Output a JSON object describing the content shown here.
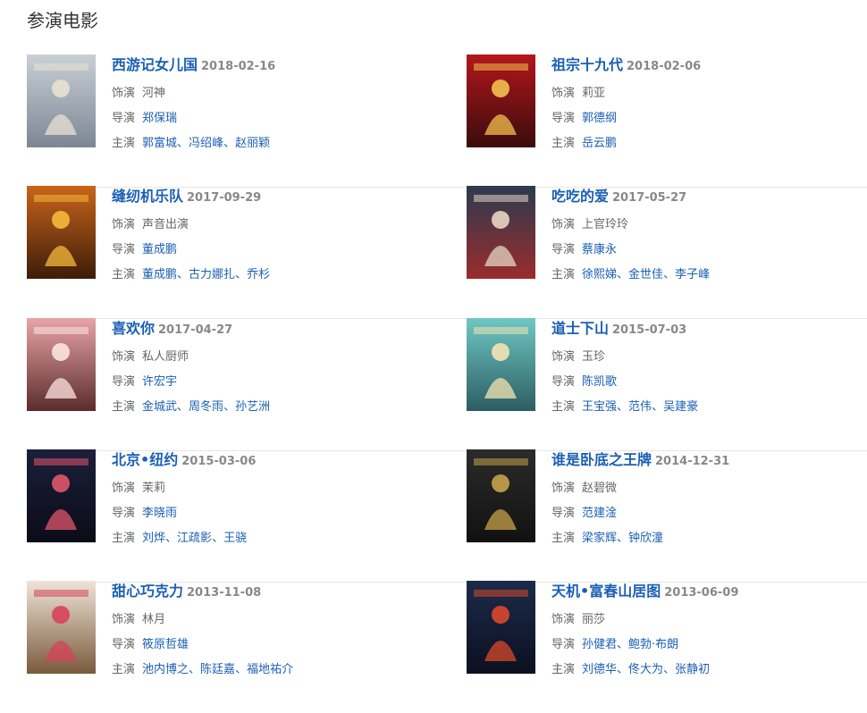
{
  "section_title": "参演电影",
  "labels": {
    "role": "饰演",
    "director": "导演",
    "starring": "主演"
  },
  "separator": "、",
  "films": [
    {
      "title": "西游记女儿国",
      "date": "2018-02-16",
      "role": "河神",
      "director": [
        "郑保瑞"
      ],
      "starring": [
        "郭富城",
        "冯绍峰",
        "赵丽颖"
      ]
    },
    {
      "title": "祖宗十九代",
      "date": "2018-02-06",
      "role": "莉亚",
      "director": [
        "郭德纲"
      ],
      "starring": [
        "岳云鹏"
      ]
    },
    {
      "title": "缝纫机乐队",
      "date": "2017-09-29",
      "role": "声音出演",
      "director": [
        "董成鹏"
      ],
      "starring": [
        "董成鹏",
        "古力娜扎",
        "乔杉"
      ]
    },
    {
      "title": "吃吃的爱",
      "date": "2017-05-27",
      "role": "上官玲玲",
      "director": [
        "蔡康永"
      ],
      "starring": [
        "徐熙娣",
        "金世佳",
        "李子峰"
      ]
    },
    {
      "title": "喜欢你",
      "date": "2017-04-27",
      "role": "私人厨师",
      "director": [
        "许宏宇"
      ],
      "starring": [
        "金城武",
        "周冬雨",
        "孙艺洲"
      ]
    },
    {
      "title": "道士下山",
      "date": "2015-07-03",
      "role": "玉珍",
      "director": [
        "陈凯歌"
      ],
      "starring": [
        "王宝强",
        "范伟",
        "吴建豪"
      ]
    },
    {
      "title": "北京•纽约",
      "date": "2015-03-06",
      "role": "茉莉",
      "director": [
        "李晓雨"
      ],
      "starring": [
        "刘烨",
        "江疏影",
        "王骁"
      ]
    },
    {
      "title": "谁是卧底之王牌",
      "date": "2014-12-31",
      "role": "赵碧微",
      "director": [
        "范建淦"
      ],
      "starring": [
        "梁家辉",
        "钟欣潼"
      ]
    },
    {
      "title": "甜心巧克力",
      "date": "2013-11-08",
      "role": "林月",
      "director": [
        "筱原哲雄"
      ],
      "starring": [
        "池内博之",
        "陈廷嘉",
        "福地祐介"
      ]
    },
    {
      "title": "天机•富春山居图",
      "date": "2013-06-09",
      "role": "丽莎",
      "director": [
        "孙健君",
        "鲍勃·布朗"
      ],
      "starring": [
        "刘德华",
        "佟大为",
        "张静初"
      ]
    }
  ],
  "posters": [
    {
      "icon": "poster-image",
      "bg": "#c9cfd6",
      "accent": "#e8e2d2",
      "dark": "#7d8794"
    },
    {
      "icon": "poster-image",
      "bg": "#b3161b",
      "accent": "#f2c14e",
      "dark": "#3a0c0c"
    },
    {
      "icon": "poster-image",
      "bg": "#c9641a",
      "accent": "#f6b93b",
      "dark": "#3d1d08"
    },
    {
      "icon": "poster-image",
      "bg": "#2c3a4f",
      "accent": "#e6d5c3",
      "dark": "#9a2c2c"
    },
    {
      "icon": "poster-image",
      "bg": "#e8a4a8",
      "accent": "#fbe4e0",
      "dark": "#5b2c2c"
    },
    {
      "icon": "poster-image",
      "bg": "#6fc7c4",
      "accent": "#f4e3b1",
      "dark": "#2d5d63"
    },
    {
      "icon": "poster-image",
      "bg": "#1b1f3a",
      "accent": "#e0566b",
      "dark": "#0b0c18"
    },
    {
      "icon": "poster-image",
      "bg": "#2b2b2b",
      "accent": "#c7a24a",
      "dark": "#111111"
    },
    {
      "icon": "poster-image",
      "bg": "#efe4d8",
      "accent": "#d6435a",
      "dark": "#7a5a3c"
    },
    {
      "icon": "poster-image",
      "bg": "#1c2a4a",
      "accent": "#d9482b",
      "dark": "#0c1020"
    }
  ]
}
